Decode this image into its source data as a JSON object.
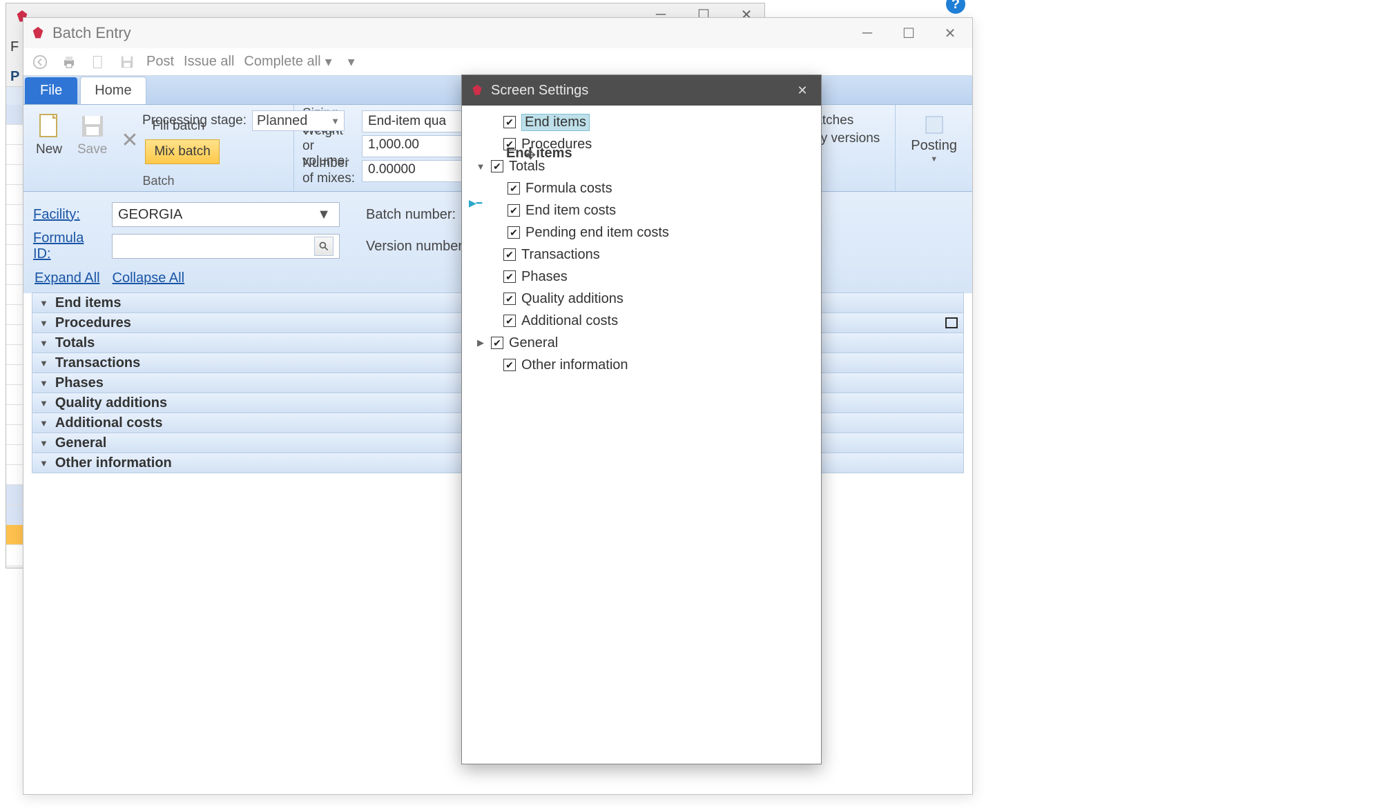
{
  "back_window": {
    "title": ""
  },
  "window": {
    "title": "Batch Entry",
    "quickbar": {
      "post": "Post",
      "issue_all": "Issue all",
      "complete_all": "Complete all"
    },
    "tabs": {
      "file": "File",
      "home": "Home"
    }
  },
  "ribbon": {
    "group_batch": "Batch",
    "new": "New",
    "save": "Save",
    "fill_batch": "Fill batch",
    "mix_batch": "Mix batch",
    "processing_stage_label": "Processing stage:",
    "processing_stage_value": "Planned",
    "sizing_mode_label": "Sizing mode:",
    "sizing_mode_value": "End-item qua",
    "weight_label": "Weight or volume:",
    "weight_value": "1,000.00",
    "mixes_label": "Number of mixes:",
    "mixes_value": "0.00000",
    "right_links": {
      "fill_batches": "ill batches",
      "primary_versions": "imary versions"
    },
    "posting": "Posting"
  },
  "form": {
    "facility_label": "Facility:",
    "facility_value": "GEORGIA",
    "batch_number_label": "Batch number:",
    "formula_id_label": "Formula ID:",
    "version_number_label": "Version number:"
  },
  "expand": {
    "expand_all": "Expand All",
    "collapse_all": "Collapse All"
  },
  "sections": [
    "End items",
    "Procedures",
    "Totals",
    "Transactions",
    "Phases",
    "Quality additions",
    "Additional costs",
    "General",
    "Other information"
  ],
  "modal": {
    "title": "Screen Settings",
    "items": {
      "end_items": "End items",
      "procedures": "Procedures",
      "totals": "Totals",
      "formula_costs": "Formula costs",
      "end_item_costs": "End item costs",
      "pending_end_item_costs": "Pending end item costs",
      "transactions": "Transactions",
      "phases": "Phases",
      "quality_additions": "Quality additions",
      "additional_costs": "Additional costs",
      "general": "General",
      "other_information": "Other information",
      "drag_ghost": "End items"
    }
  },
  "help": "?"
}
